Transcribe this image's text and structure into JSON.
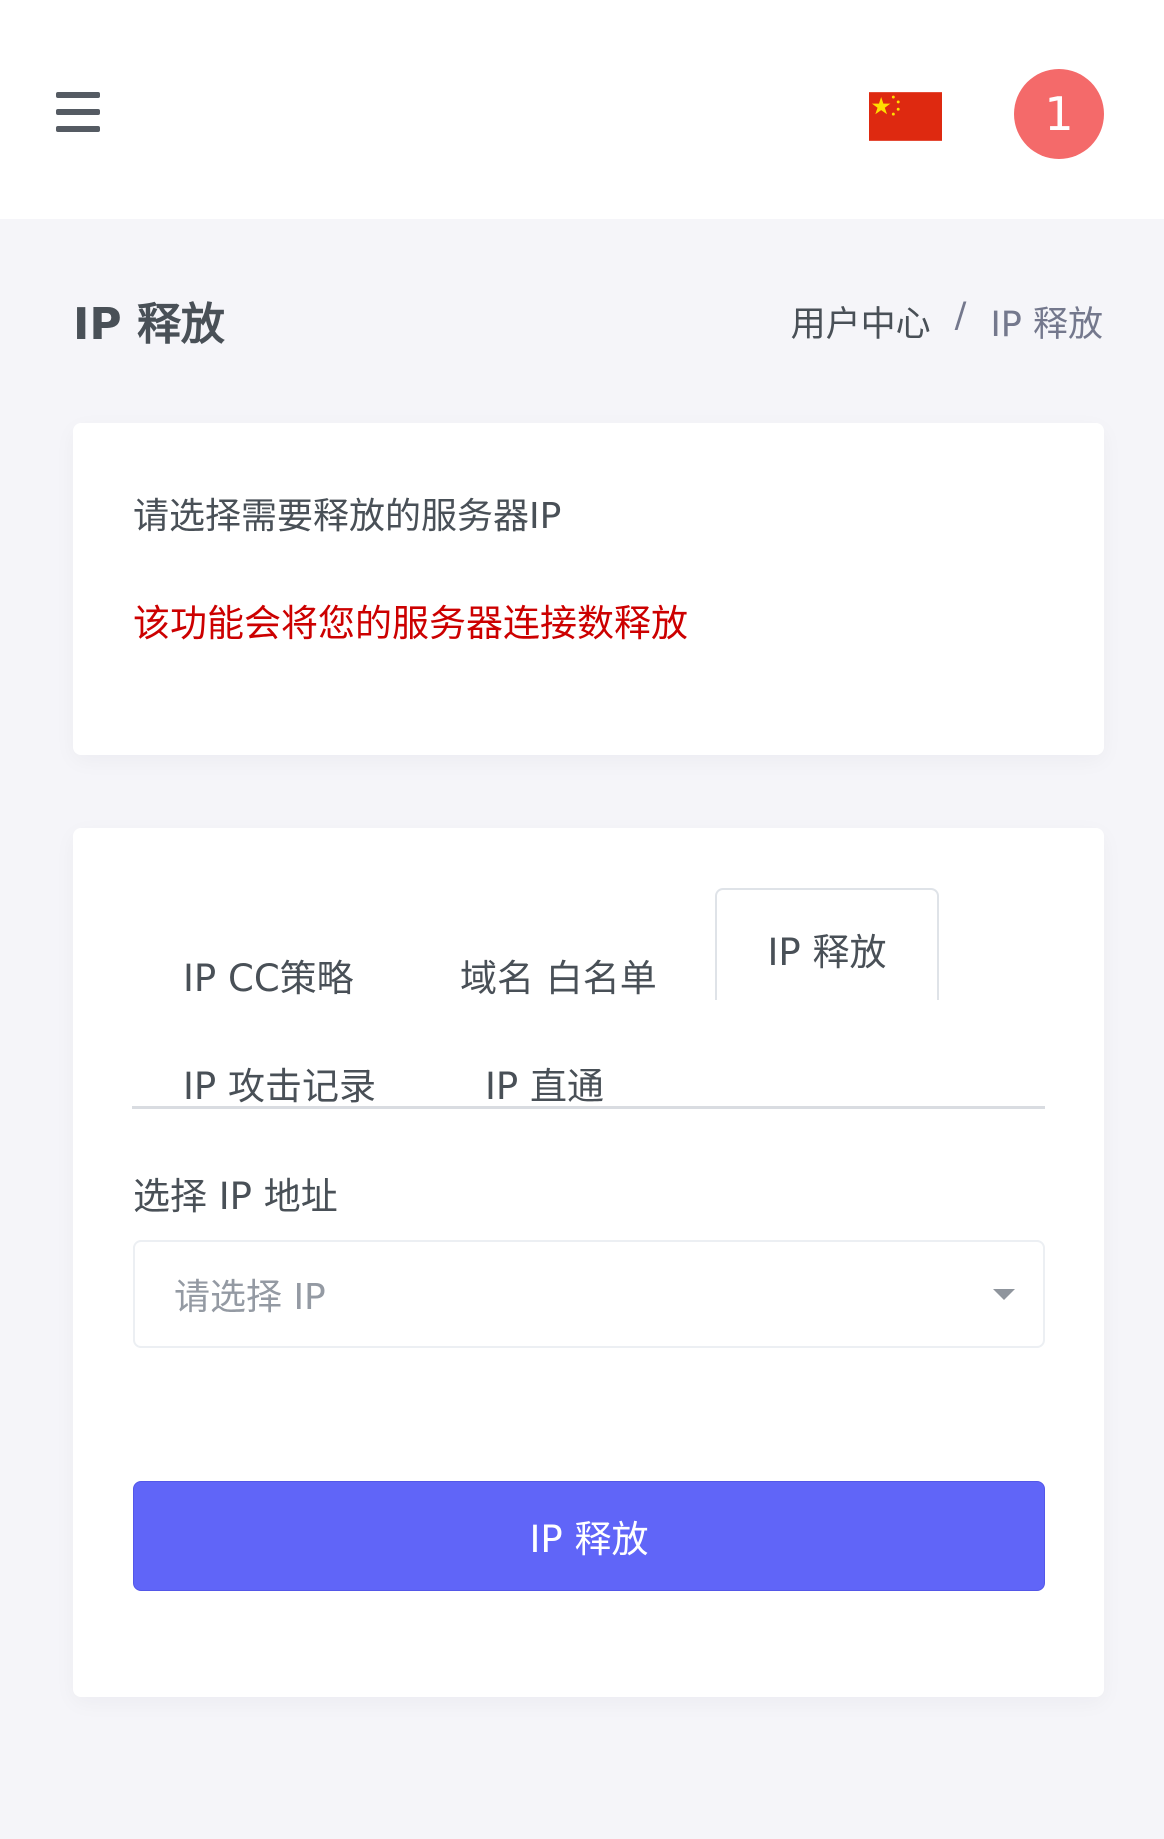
{
  "header": {
    "menu_icon": "hamburger-menu-icon",
    "flag_icon": "china-flag-icon",
    "avatar_text": "1",
    "avatar_color": "#f46a6a"
  },
  "page": {
    "title": "IP 释放",
    "breadcrumb": {
      "home": "用户中心",
      "separator": "/",
      "current": "IP 释放"
    }
  },
  "notice": {
    "info": "请选择需要释放的服务器IP",
    "warning": "该功能会将您的服务器连接数释放",
    "warning_color": "#cc0000"
  },
  "tabs": [
    {
      "label": "IP CC策略"
    },
    {
      "label": "域名 白名单"
    },
    {
      "label": "IP 释放",
      "active": true
    },
    {
      "label": "IP 攻击记录"
    },
    {
      "label": "IP 直通"
    }
  ],
  "form": {
    "ip_label": "选择 IP 地址",
    "ip_placeholder": "请选择 IP",
    "submit_label": "IP 释放",
    "accent_color": "#6065f8"
  }
}
